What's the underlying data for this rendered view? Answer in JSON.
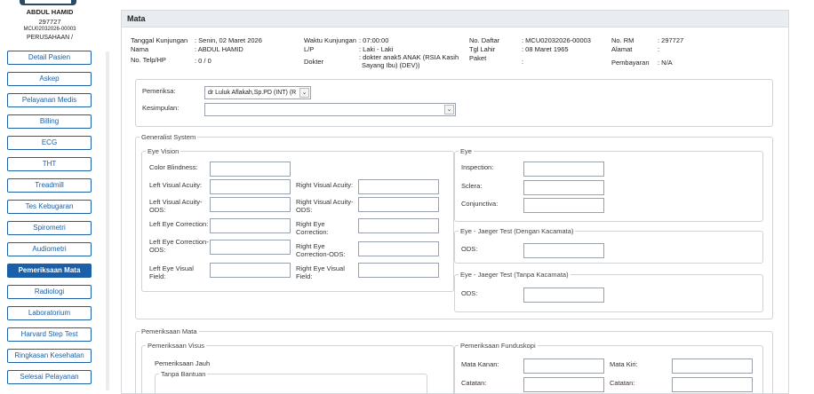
{
  "patient": {
    "name": "ABDUL HAMID",
    "id": "297727",
    "reg": "MCU02032026-00003",
    "company": "PERUSAHAAN /"
  },
  "sidebar": {
    "items": [
      {
        "label": "Detail Pasien"
      },
      {
        "label": "Askep"
      },
      {
        "label": "Pelayanan Medis"
      },
      {
        "label": "Billing"
      },
      {
        "label": "ECG"
      },
      {
        "label": "THT"
      },
      {
        "label": "Treadmill"
      },
      {
        "label": "Tes Kebugaran"
      },
      {
        "label": "Spirometri"
      },
      {
        "label": "Audiometri"
      },
      {
        "label": "Pemeriksaan Mata",
        "active": true
      },
      {
        "label": "Radiologi"
      },
      {
        "label": "Laboratorium"
      },
      {
        "label": "Harvard Step Test"
      },
      {
        "label": "Ringkasan Kesehatan"
      },
      {
        "label": "Selesai Pelayanan"
      }
    ]
  },
  "panel": {
    "title": "Mata"
  },
  "info": {
    "tanggal_label": "Tanggal Kunjungan",
    "tanggal_value": ": Senin, 02 Maret 2026",
    "nama_label": "Nama",
    "nama_value": ": ABDUL HAMID",
    "telp_label": "No. Telp/HP",
    "telp_value": ": 0 / 0",
    "waktu_label": "Waktu Kunjungan",
    "waktu_value": ": 07:00:00",
    "lp_label": "L/P",
    "lp_value": ": Laki - Laki",
    "dokter_label": "Dokter",
    "dokter_value_1": ": dokter anak5 ANAK (RSIA Kasih",
    "dokter_value_2": "Sayang Ibu) (DEV))",
    "daftar_label": "No. Daftar",
    "daftar_value": ": MCU02032026-00003",
    "lahir_label": "Tgl Lahir",
    "lahir_value": ": 08 Maret 1965",
    "paket_label": "Paket",
    "paket_value": ":",
    "rm_label": "No. RM",
    "rm_value": ": 297727",
    "alamat_label": "Alamat",
    "alamat_value": ":",
    "bayar_label": "Pembayaran",
    "bayar_value": ": N/A"
  },
  "form": {
    "pemeriksa_label": "Pemeriksa:",
    "pemeriksa_value": "dr Luluk Aflakah,Sp.PD (INT) (R",
    "kesimpulan_label": "Kesimpulan:",
    "kesimpulan_value": ""
  },
  "generalist": {
    "legend": "Generalist System",
    "eye_vision": {
      "legend": "Eye Vision",
      "color_blindness": "Color Blindness:",
      "left_va": "Left Visual Acuity:",
      "right_va": "Right Visual Acuity:",
      "left_va_ods_1": "Left Visual Acuity-",
      "left_va_ods_2": "ODS:",
      "right_va_ods_1": "Right Visual Acuity-",
      "right_va_ods_2": "ODS:",
      "left_ec": "Left Eye Correction:",
      "right_ec_1": "Right Eye",
      "right_ec_2": "Correction:",
      "left_ec_ods_1": "Left Eye Correction-",
      "left_ec_ods_2": "ODS:",
      "right_ec_ods_1": "Right Eye",
      "right_ec_ods_2": "Correction-ODS:",
      "left_vf_1": "Left Eye Visual",
      "left_vf_2": "Field:",
      "right_vf_1": "Right Eye Visual",
      "right_vf_2": "Field:"
    },
    "eye": {
      "legend": "Eye",
      "inspection": "Inspection:",
      "sclera": "Sclera:",
      "conjunctiva": "Conjunctiva:"
    },
    "jaeger_dengan": {
      "legend": "Eye - Jaeger Test (Dengan Kacamata)",
      "ods": "ODS:"
    },
    "jaeger_tanpa": {
      "legend": "Eye - Jaeger Test (Tanpa Kacamata)",
      "ods": "ODS:"
    }
  },
  "pemeriksaan_mata": {
    "legend": "Pemeriksaan Mata",
    "visus": {
      "legend": "Pemeriksaan Visus",
      "jauh": "Pemeriksaan Jauh",
      "tanpa": "Tanpa Bantuan"
    },
    "funduskopi": {
      "legend": "Pemeriksaan Funduskopi",
      "mata_kanan": "Mata Kanan:",
      "mata_kiri": "Mata Kiri:",
      "catatan_kanan": "Catatan:",
      "catatan_kiri": "Catatan:"
    }
  }
}
